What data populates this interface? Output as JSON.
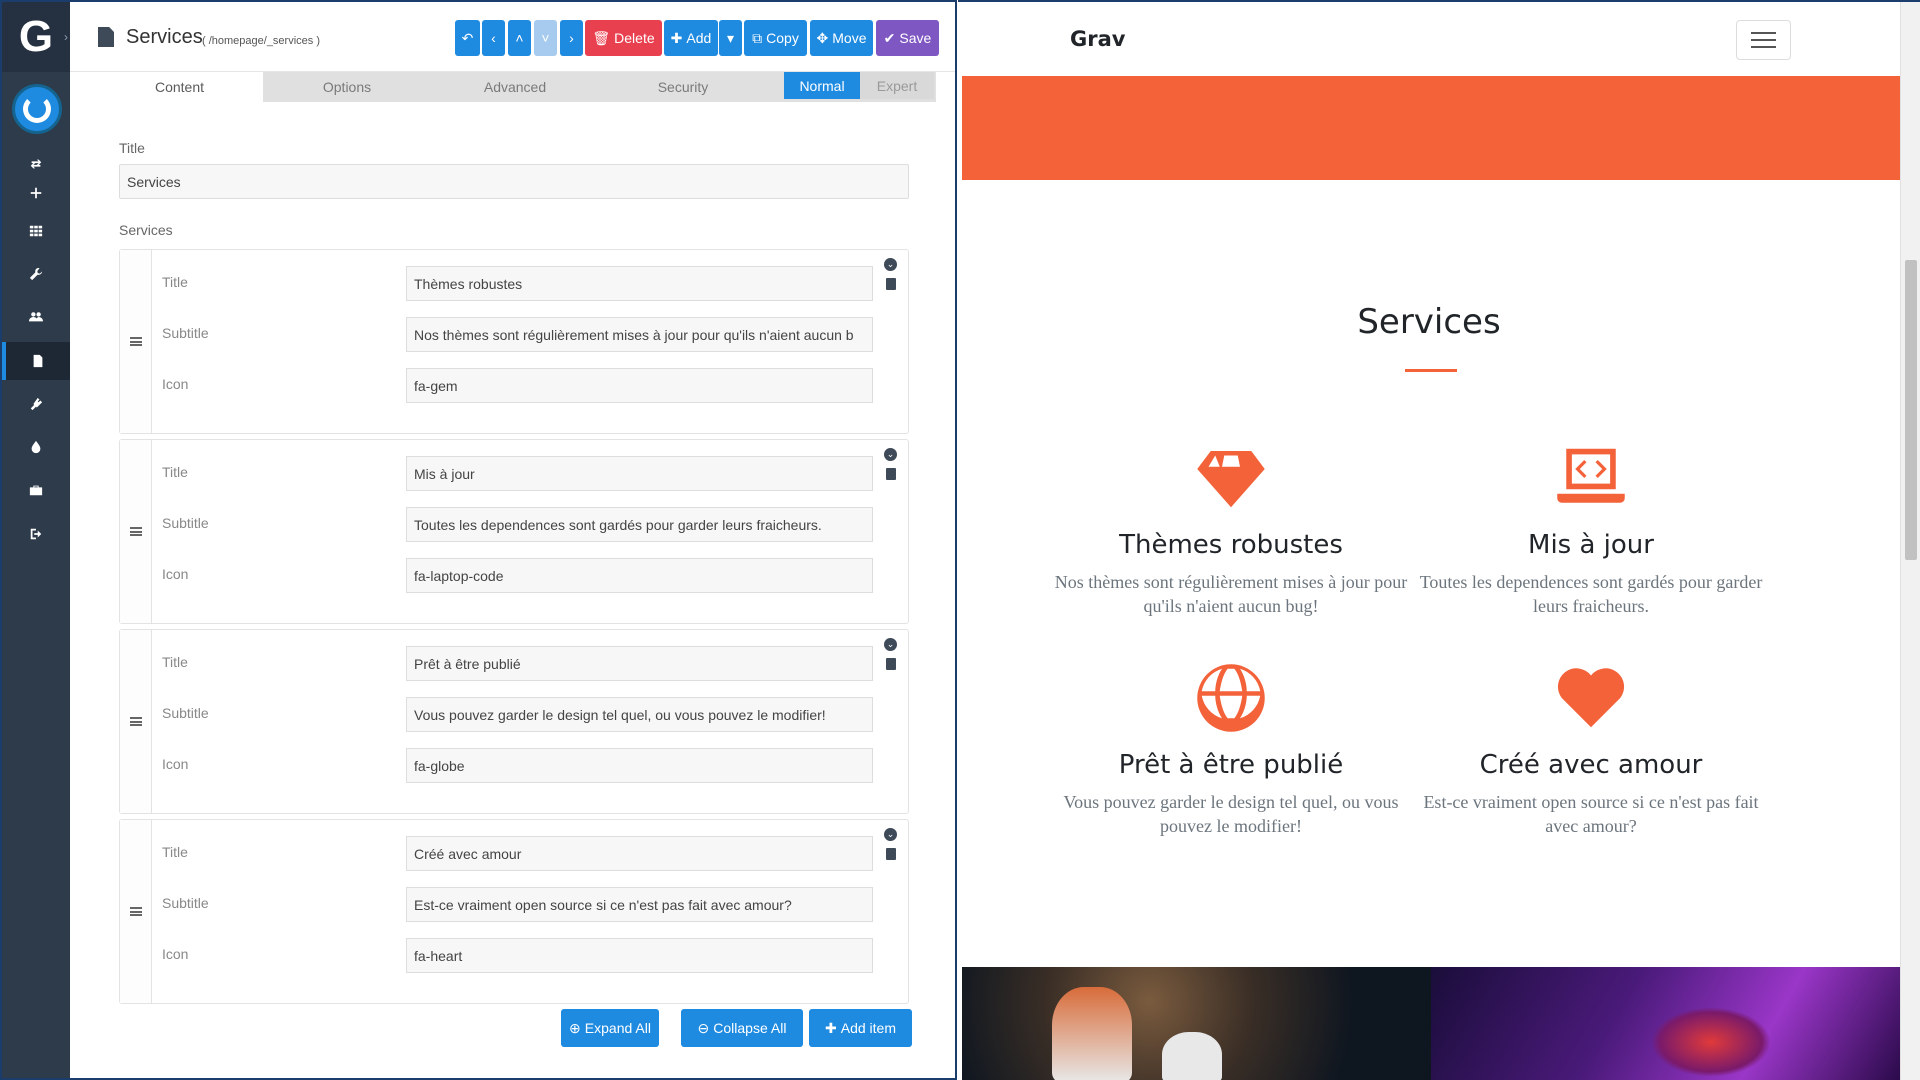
{
  "admin": {
    "logo": "G",
    "page_title": "Services",
    "page_route": "( /homepage/_services )",
    "toolbar": {
      "delete": "Delete",
      "add": "Add",
      "copy": "Copy",
      "move": "Move",
      "save": "Save"
    },
    "tabs": [
      "Content",
      "Options",
      "Advanced",
      "Security"
    ],
    "mode": {
      "normal": "Normal",
      "expert": "Expert"
    },
    "title_label": "Title",
    "title_value": "Services",
    "services_label": "Services",
    "field_labels": {
      "title": "Title",
      "subtitle": "Subtitle",
      "icon": "Icon"
    },
    "services": [
      {
        "title": "Thèmes robustes",
        "subtitle": "Nos thèmes sont régulièrement mises à jour pour qu'ils n'aient aucun b",
        "icon": "fa-gem"
      },
      {
        "title": "Mis à jour",
        "subtitle": "Toutes les dependences sont gardés pour garder leurs fraicheurs.",
        "icon": "fa-laptop-code"
      },
      {
        "title": "Prêt à être publié",
        "subtitle": "Vous pouvez garder le design tel quel, ou vous pouvez le modifier!",
        "icon": "fa-globe"
      },
      {
        "title": "Créé avec amour",
        "subtitle": "Est-ce vraiment open source si ce n'est pas fait avec amour?",
        "icon": "fa-heart"
      }
    ],
    "bottom_buttons": {
      "expand": "Expand All",
      "collapse": "Collapse All",
      "add_item": "Add item"
    },
    "colors": {
      "primary": "#1e8ae0",
      "danger": "#e9404f",
      "save": "#7e57c2",
      "sidebar": "#2d3b4a"
    }
  },
  "preview": {
    "brand": "Grav",
    "section_title": "Services",
    "accent": "#f4623a",
    "services": [
      {
        "icon": "gem-icon",
        "title": "Thèmes robustes",
        "text": "Nos thèmes sont régulièrement mises à jour pour qu'ils n'aient aucun bug!"
      },
      {
        "icon": "laptop-code-icon",
        "title": "Mis à jour",
        "text": "Toutes les dependences sont gardés pour garder leurs fraicheurs."
      },
      {
        "icon": "globe-icon",
        "title": "Prêt à être publié",
        "text": "Vous pouvez garder le design tel quel, ou vous pouvez le modifier!"
      },
      {
        "icon": "heart-icon",
        "title": "Créé avec amour",
        "text": "Est-ce vraiment open source si ce n'est pas fait avec amour?"
      }
    ]
  }
}
